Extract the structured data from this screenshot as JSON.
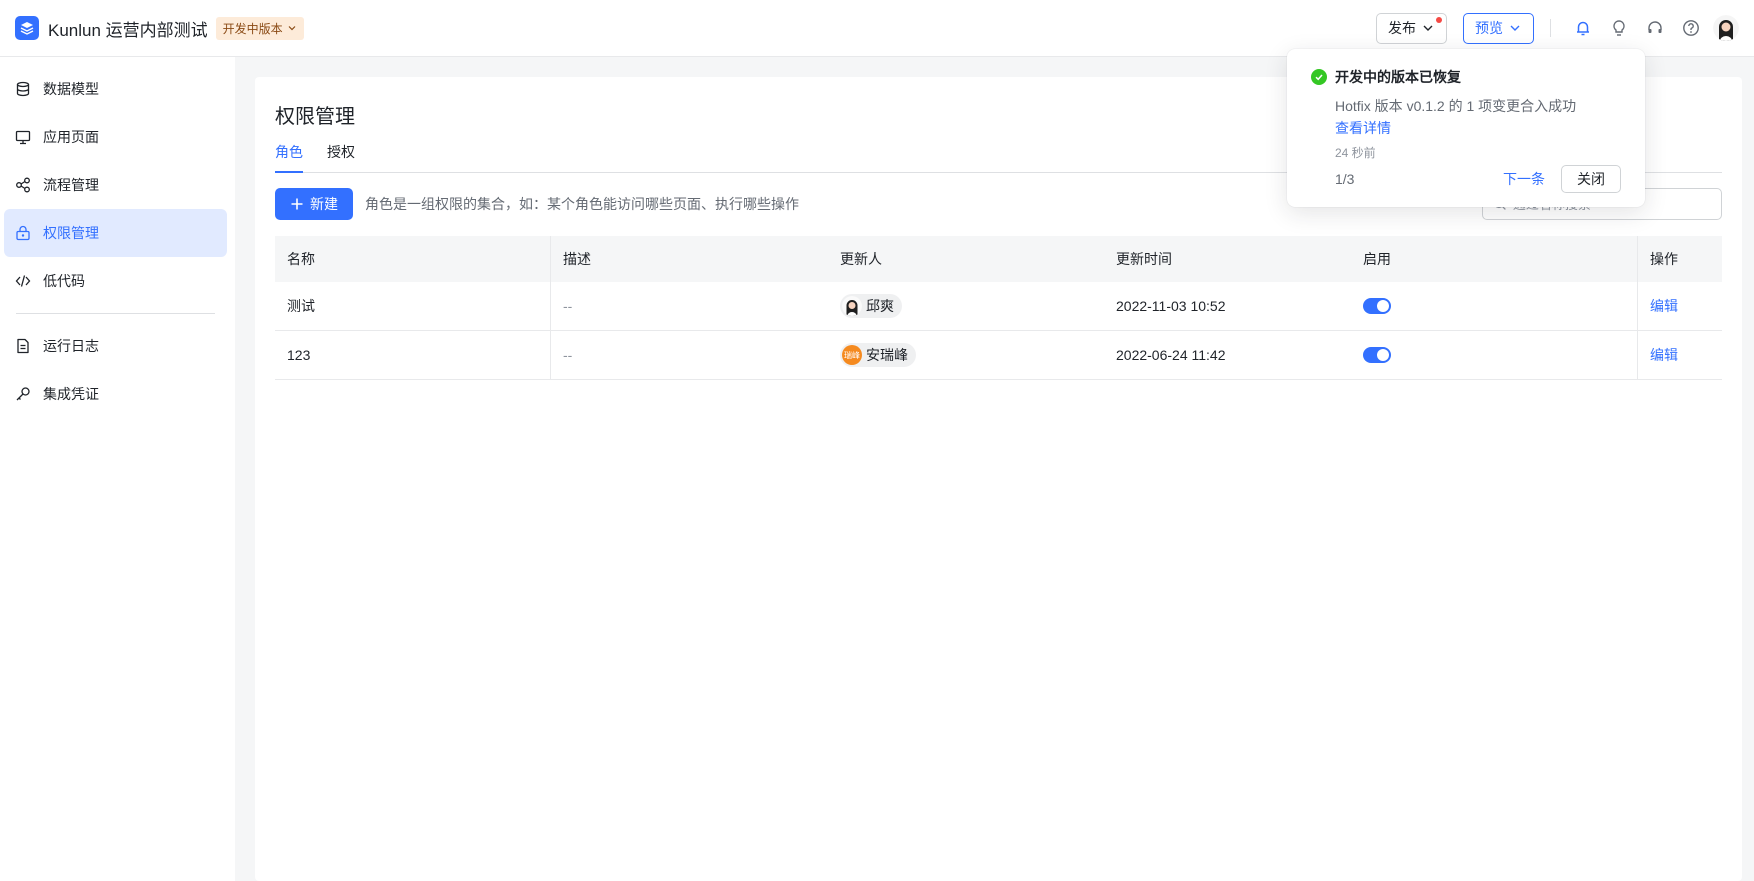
{
  "header": {
    "app_title": "Kunlun 运营内部测试",
    "version_badge": "开发中版本",
    "publish_label": "发布",
    "preview_label": "预览",
    "icons": [
      "bell-icon",
      "bulb-icon",
      "headset-icon",
      "help-icon"
    ]
  },
  "sidebar": {
    "items": [
      {
        "label": "数据模型",
        "icon": "database-icon"
      },
      {
        "label": "应用页面",
        "icon": "monitor-icon"
      },
      {
        "label": "流程管理",
        "icon": "flow-icon"
      },
      {
        "label": "权限管理",
        "icon": "lock-icon",
        "active": true
      },
      {
        "label": "低代码",
        "icon": "code-icon"
      },
      {
        "label": "运行日志",
        "icon": "log-file-icon"
      },
      {
        "label": "集成凭证",
        "icon": "key-icon"
      }
    ]
  },
  "main": {
    "title": "权限管理",
    "tabs": [
      {
        "label": "角色"
      },
      {
        "label": "授权"
      }
    ],
    "new_button": "新建",
    "hint": "角色是一组权限的集合，如：某个角色能访问哪些页面、执行哪些操作",
    "search_placeholder": "通过名称搜索",
    "table": {
      "headers": [
        "名称",
        "描述",
        "更新人",
        "更新时间",
        "启用",
        "操作"
      ],
      "rows": [
        {
          "name": "测试",
          "desc": "--",
          "user": "邱爽",
          "time": "2022-11-03 10:52",
          "enabled": true,
          "op": "编辑"
        },
        {
          "name": "123",
          "desc": "--",
          "user": "安瑞峰",
          "avatar_text": "瑞峰",
          "time": "2022-06-24 11:42",
          "enabled": true,
          "op": "编辑"
        }
      ]
    }
  },
  "notification": {
    "title": "开发中的版本已恢复",
    "body": "Hotfix 版本 v0.1.2 的 1 项变更合入成功",
    "link": "查看详情",
    "time": "24 秒前",
    "counter": "1/3",
    "next": "下一条",
    "close": "关闭"
  },
  "colors": {
    "accent": "#3370ff",
    "success": "#34c724",
    "badge_bg": "#fdebd9"
  }
}
